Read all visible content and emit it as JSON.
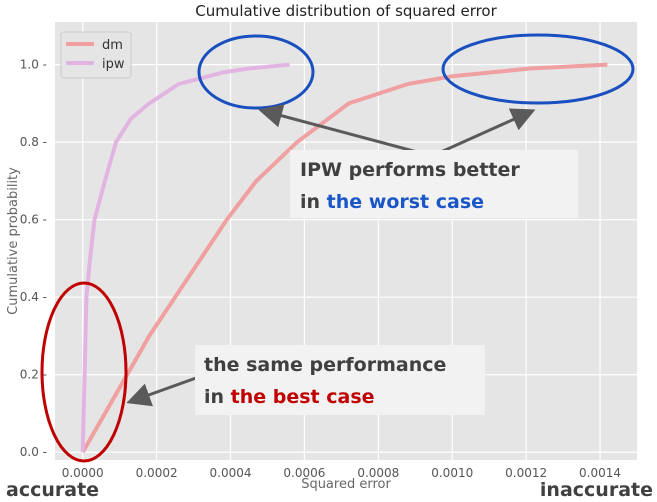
{
  "chart_data": {
    "type": "line",
    "title": "Cumulative distribution of squared error",
    "xlabel": "Squared error",
    "ylabel": "Cumulative probability",
    "xlim": [
      -7.5e-05,
      0.0015
    ],
    "ylim": [
      -0.02,
      1.11
    ],
    "xticks": [
      "0.0000",
      "0.0002",
      "0.0004",
      "0.0006",
      "0.0008",
      "0.0010",
      "0.0012",
      "0.0014"
    ],
    "xtick_values": [
      0,
      0.0002,
      0.0004,
      0.0006,
      0.0008,
      0.001,
      0.0012,
      0.0014
    ],
    "yticks": [
      "0.0",
      "0.2",
      "0.4",
      "0.6",
      "0.8",
      "1.0"
    ],
    "ytick_values": [
      0,
      0.2,
      0.4,
      0.6,
      0.8,
      1.0
    ],
    "grid": true,
    "legend_placement": "top-left",
    "series": [
      {
        "name": "dm",
        "color": "#f0a0a0",
        "x": [
          0,
          6e-05,
          0.00012,
          0.00018,
          0.00025,
          0.00032,
          0.00039,
          0.00047,
          0.00058,
          0.00072,
          0.00088,
          0.001,
          0.00121,
          0.00142
        ],
        "y": [
          0,
          0.1,
          0.2,
          0.3,
          0.4,
          0.5,
          0.6,
          0.7,
          0.8,
          0.9,
          0.95,
          0.97,
          0.99,
          1.0
        ]
      },
      {
        "name": "ipw",
        "color": "#e2b4e2",
        "x": [
          0,
          5e-06,
          1e-05,
          2e-05,
          3.2e-05,
          6e-05,
          9e-05,
          0.00013,
          0.00018,
          0.00026,
          0.00038,
          0.00045,
          0.00056
        ],
        "y": [
          0,
          0.2,
          0.4,
          0.5,
          0.6,
          0.7,
          0.8,
          0.86,
          0.9,
          0.95,
          0.98,
          0.99,
          1.0
        ]
      }
    ],
    "annotations": {
      "worst_line1": "IPW performs better",
      "worst_prefix": "in ",
      "worst_highlight": "the worst case",
      "worst_color": "#1a56c8",
      "best_line1": "the same performance",
      "best_prefix": "in ",
      "best_highlight": "the best case",
      "best_color": "#c00000",
      "left_label": "accurate",
      "right_label": "inaccurate"
    }
  }
}
